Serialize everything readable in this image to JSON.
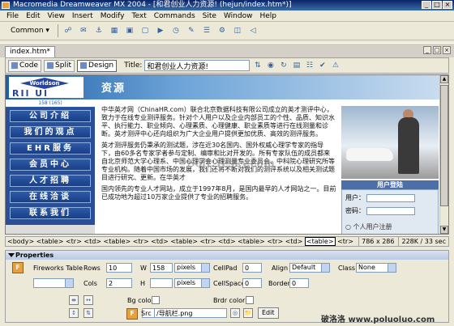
{
  "window": {
    "title": "Macromedia Dreamweaver MX 2004 - [和君创业人力资源! (hejun/index.htm*)]",
    "controls": [
      "_",
      "□",
      "×"
    ]
  },
  "menu": [
    "File",
    "Edit",
    "View",
    "Insert",
    "Modify",
    "Text",
    "Commands",
    "Site",
    "Window",
    "Help"
  ],
  "toolbar": {
    "category": "Common ▾",
    "icons": [
      "hyperlink-icon",
      "email-icon",
      "named-anchor-icon",
      "table-icon",
      "layer-icon",
      "image-icon",
      "media-icon",
      "date-icon",
      "comment-icon",
      "head-icon",
      "script-icon",
      "template-icon",
      "tag-chooser-icon"
    ]
  },
  "document": {
    "tab": "index.htm*",
    "view_buttons": [
      "Code",
      "Split",
      "Design"
    ],
    "title_label": "Title:",
    "title_value": "和君创业人力资源!"
  },
  "page": {
    "logo_text": "Worldson",
    "logo_letters": "RIl    Ul",
    "header_tag": "资源",
    "dim_label": "158 (165)",
    "nav": [
      "公司介绍",
      "我们的观点",
      "EHR服务",
      "会员中心",
      "人才招聘",
      "在线洽谈",
      "联系我们"
    ],
    "paragraphs": [
      "中华英才网（ChinaHR.com）联合北京数据科技有限公司成立的英才测评中心，致力于在线专业测评服务。针对个人用户以及企业内部员工的个性、品质、知识水平、执行能力、职业倾向、心理素质、心理健康、职业素质等进行在线测量和诊断。英才测评中心还向组织为广大企业用户提供更加优质、高效的测评服务。",
      "英才测评服务仍秉承的测试题，涉在近30名国内、国外权威心理学专家的指导下，由60多名专家学者参与定制、编审和比对开发的。所有专家队伍的成员都来自北京师范大学心理系、中国心理学会心理测量专业委员会、中科院心理研究所等专业机构。随着中国市场的发展，我们还将不断对我们的测评系统以及相关测试题目进行研究、更新。在华英才",
      "国内领先的专业人才网站，成立于1997年8月，是国内最早的人才网站之一。目前已成功地为超过10万家企业提供了专业的招聘服务。"
    ],
    "login": {
      "title": "用户登陆",
      "user_label": "用户：",
      "pass_label": "密码：",
      "radio_text": "○ 个人用户注册"
    },
    "watermark": "Soft.Yesky.com"
  },
  "statusbar": {
    "tags": [
      "<body>",
      "<table>",
      "<tr>",
      "<td>",
      "<table>",
      "<tr>",
      "<td>",
      "<table>",
      "<tr>",
      "<td>",
      "<table>",
      "<tr>",
      "<td>"
    ],
    "selected_tag": "<table>",
    "tags_after": [
      "<tr>",
      "<td>",
      "<a>",
      "<img>"
    ],
    "window_size": "786 x 286",
    "file_size": "228K / 33 sec"
  },
  "properties": {
    "header": "Properties",
    "type_label": "Fireworks Table",
    "rows_label": "Rows",
    "rows_value": "10",
    "cols_label": "Cols",
    "cols_value": "2",
    "w_label": "W",
    "w_value": "158",
    "w_unit": "pixels",
    "h_label": "H",
    "h_value": "",
    "h_unit": "pixels",
    "cellpad_label": "CellPad",
    "cellpad_value": "0",
    "cellspace_label": "CellSpace",
    "cellspace_value": "0",
    "align_label": "Align",
    "align_value": "Default",
    "border_label": "Border",
    "border_value": "0",
    "class_label": "Class",
    "class_value": "None",
    "bgcolor_label": "Bg color",
    "brdrcolor_label": "Brdr color",
    "bg_label": "Bg",
    "src_label": "Src",
    "src_value": "/导航栏.png",
    "edit_label": "Edit",
    "fw_letter": "F"
  },
  "site_watermark": "破洛洛  www.poluoluo.com"
}
